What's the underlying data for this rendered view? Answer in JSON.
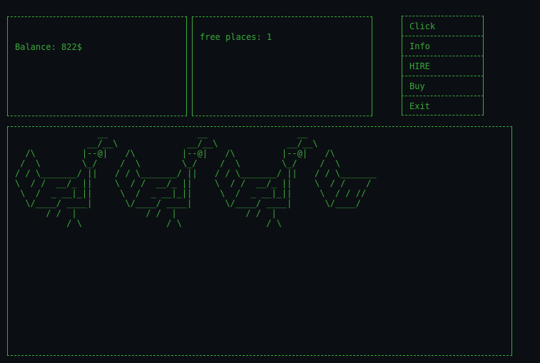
{
  "stats": {
    "balance_label": "Balance: 822$",
    "free_places_label": "free places: 1"
  },
  "menu": {
    "items": [
      {
        "label": "Click"
      },
      {
        "label": "Info"
      },
      {
        "label": "HIRE"
      },
      {
        "label": "Buy"
      },
      {
        "label": "Exit"
      }
    ]
  },
  "farm": {
    "chickens": [
      "                __\n              __/__\\\n  /\\         |--@|\n /  \\        \\_/\n/ / \\_______/ ||\n\\  / /  __/_ ||\n \\  /  _ __|_||\n  \\/____/ ____|\n      / /  |\n          / \\",
      "                __\n              __/__\\\n  /\\         |--@|\n /  \\        \\_/\n/ / \\_______/ ||\n\\  / /  __/_ ||\n \\  /  _ __|_||\n  \\/____/ ____|\n      / /  |\n          / \\",
      "                __\n              __/__\\\n  /\\         |--@|\n /  \\        \\_/\n/ / \\_______/ ||\n\\  / /  __/_ ||\n \\  /  _ __|_||\n  \\/____/ ____|\n      / /  |\n          / \\",
      "\n\n  /\\\n /  \\\n/ / \\_______\n\\  / /    /\n \\  / / //\n  \\/____/"
    ]
  }
}
